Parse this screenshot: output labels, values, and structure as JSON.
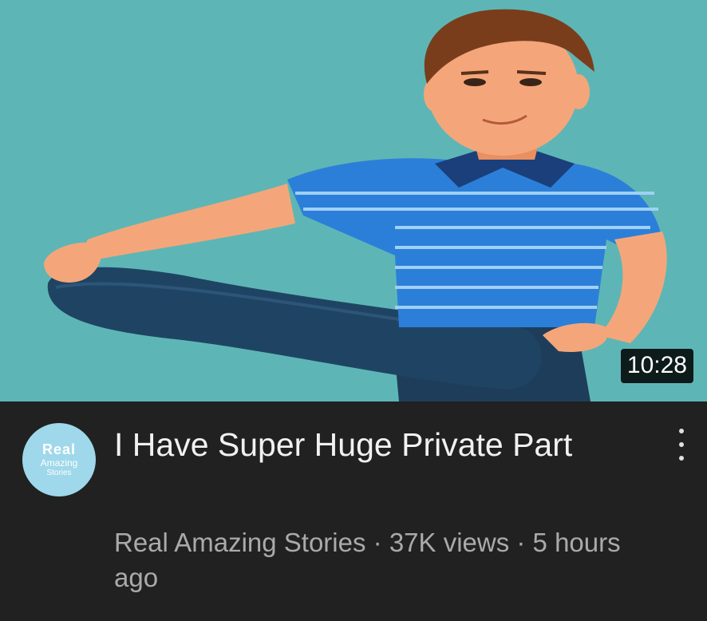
{
  "video": {
    "duration": "10:28",
    "title": "I Have Super Huge Private Part",
    "channel": "Real Amazing Stories",
    "separator": " · ",
    "views": "37K views",
    "age": "5 hours ago"
  },
  "channel_avatar": {
    "line1": "Real",
    "line2": "Amazing",
    "line3": "Stories"
  },
  "menu": {
    "icon": "more-vertical-icon"
  },
  "colors": {
    "thumbnail_bg": "#5db6b5",
    "meta_bg": "#212121",
    "title_text": "#f1f1f1",
    "secondary_text": "#aaaaaa"
  }
}
